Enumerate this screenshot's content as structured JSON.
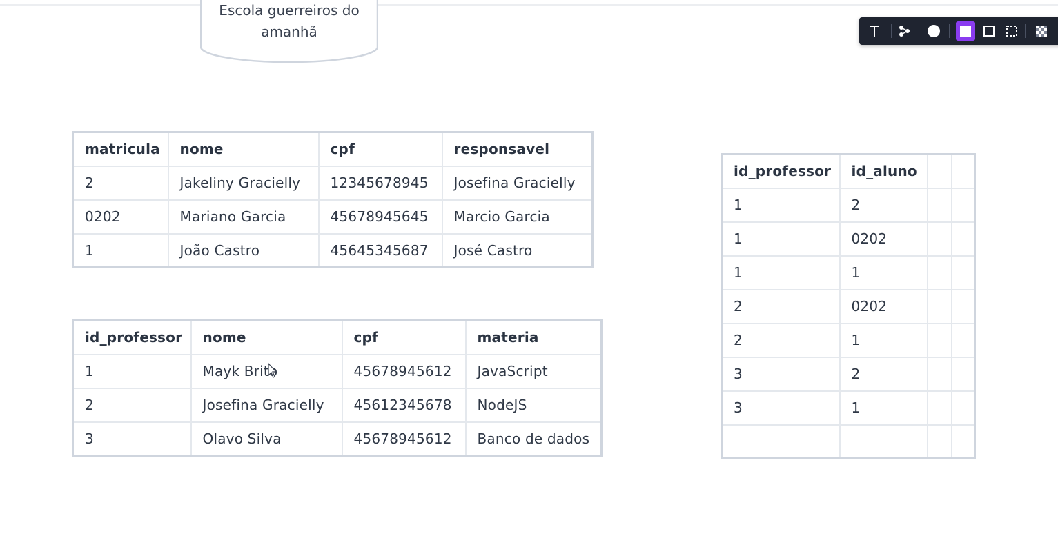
{
  "cylinder": {
    "line1": "Escola guerreiros do",
    "line2": "amanhã"
  },
  "toolbar": {
    "items": [
      {
        "icon": "text-icon"
      },
      {
        "icon": "connector-icon"
      },
      {
        "icon": "circle-fill-icon"
      },
      {
        "icon": "square-filled-icon",
        "active": true
      },
      {
        "icon": "square-outline-icon"
      },
      {
        "icon": "square-dashed-icon"
      },
      {
        "icon": "checker-icon"
      }
    ],
    "accent": "#8a3cf0"
  },
  "alunos_table": {
    "headers": [
      "matricula",
      "nome",
      "cpf",
      "responsavel"
    ],
    "rows": [
      [
        "2",
        "Jakeliny Gracielly",
        "12345678945",
        "Josefina Gracielly"
      ],
      [
        "0202",
        "Mariano Garcia",
        "45678945645",
        "Marcio Garcia"
      ],
      [
        "1",
        "João Castro",
        "45645345687",
        "José Castro"
      ]
    ]
  },
  "professores_table": {
    "headers": [
      "id_professor",
      "nome",
      "cpf",
      "materia"
    ],
    "rows": [
      [
        "1",
        "Mayk Brito",
        "45678945612",
        "JavaScript"
      ],
      [
        "2",
        "Josefina Gracielly",
        "45612345678",
        "NodeJS"
      ],
      [
        "3",
        "Olavo Silva",
        "45678945612",
        "Banco de dados"
      ]
    ]
  },
  "relacao_table": {
    "headers": [
      "id_professor",
      "id_aluno",
      "",
      ""
    ],
    "rows": [
      [
        "1",
        "2",
        "",
        ""
      ],
      [
        "1",
        "0202",
        "",
        ""
      ],
      [
        "1",
        "1",
        "",
        ""
      ],
      [
        "2",
        "0202",
        "",
        ""
      ],
      [
        "2",
        "1",
        "",
        ""
      ],
      [
        "3",
        "2",
        "",
        ""
      ],
      [
        "3",
        "1",
        "",
        ""
      ],
      [
        "",
        "",
        "",
        ""
      ]
    ]
  }
}
